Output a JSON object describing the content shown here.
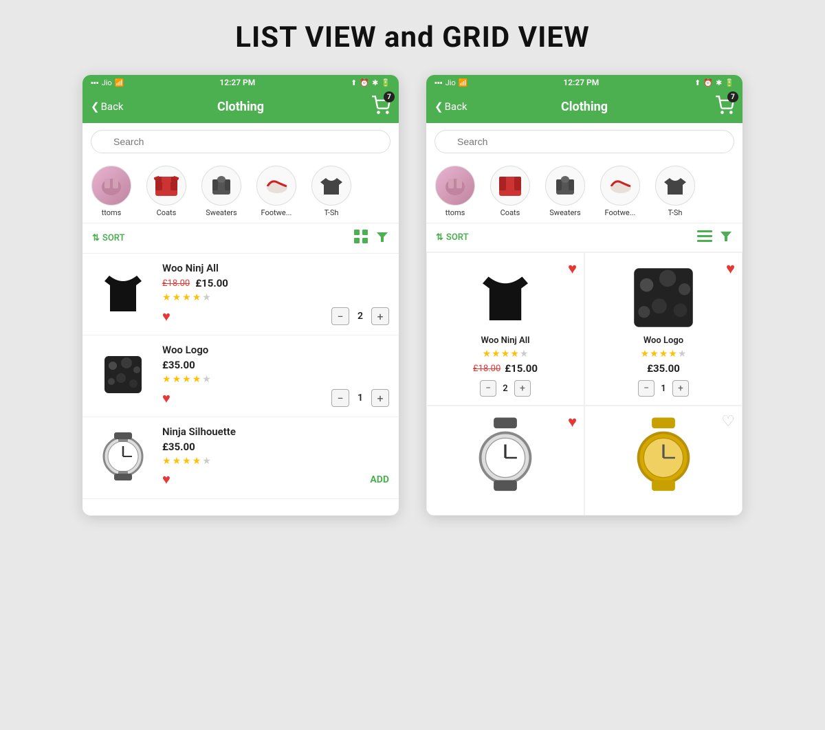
{
  "page": {
    "title": "LIST VIEW and GRID VIEW"
  },
  "left_phone": {
    "status": {
      "carrier": "Jio",
      "time": "12:27 PM",
      "battery": "■"
    },
    "nav": {
      "back_label": "Back",
      "title": "Clothing",
      "cart_count": "7"
    },
    "search": {
      "placeholder": "Search"
    },
    "categories": [
      {
        "label": "ttoms",
        "color": "#d4a0b5"
      },
      {
        "label": "Coats",
        "color": "#cc3333"
      },
      {
        "label": "Sweaters",
        "color": "#555"
      },
      {
        "label": "Footwe...",
        "color": "#f0f0f0"
      },
      {
        "label": "T-Sh",
        "color": "#444"
      }
    ],
    "toolbar": {
      "sort_label": "SORT",
      "view_icon": "grid",
      "filter_icon": "filter"
    },
    "products": [
      {
        "name": "Woo Ninj All",
        "old_price": "£18.00",
        "new_price": "£15.00",
        "rating": 4,
        "has_old_price": true,
        "quantity": "2",
        "show_add": false,
        "heart_filled": true
      },
      {
        "name": "Woo Logo",
        "old_price": "",
        "new_price": "£35.00",
        "rating": 4,
        "has_old_price": false,
        "quantity": "1",
        "show_add": false,
        "heart_filled": true
      },
      {
        "name": "Ninja Silhouette",
        "old_price": "",
        "new_price": "£35.00",
        "rating": 4,
        "has_old_price": false,
        "quantity": "",
        "show_add": true,
        "heart_filled": true
      }
    ]
  },
  "right_phone": {
    "status": {
      "carrier": "Jio",
      "time": "12:27 PM"
    },
    "nav": {
      "back_label": "Back",
      "title": "Clothing",
      "cart_count": "7"
    },
    "search": {
      "placeholder": "Search"
    },
    "categories": [
      {
        "label": "ttoms",
        "color": "#d4a0b5"
      },
      {
        "label": "Coats",
        "color": "#cc3333"
      },
      {
        "label": "Sweaters",
        "color": "#555"
      },
      {
        "label": "Footwe...",
        "color": "#f0f0f0"
      },
      {
        "label": "T-Sh",
        "color": "#444"
      }
    ],
    "toolbar": {
      "sort_label": "SORT",
      "view_icon": "list",
      "filter_icon": "filter"
    },
    "grid_products": [
      {
        "name": "Woo Ninj All",
        "old_price": "£18.00",
        "new_price": "£15.00",
        "rating": 4,
        "has_old_price": true,
        "quantity": "2",
        "heart_filled": true
      },
      {
        "name": "Woo Logo",
        "old_price": "",
        "new_price": "£35.00",
        "rating": 4,
        "has_old_price": false,
        "quantity": "1",
        "heart_filled": true
      },
      {
        "name": "",
        "old_price": "",
        "new_price": "",
        "rating": 0,
        "has_old_price": false,
        "quantity": "",
        "heart_filled": true,
        "is_watch": true
      },
      {
        "name": "",
        "old_price": "",
        "new_price": "",
        "rating": 0,
        "has_old_price": false,
        "quantity": "",
        "heart_filled": false,
        "is_watch": true,
        "is_gold_watch": true
      }
    ]
  }
}
